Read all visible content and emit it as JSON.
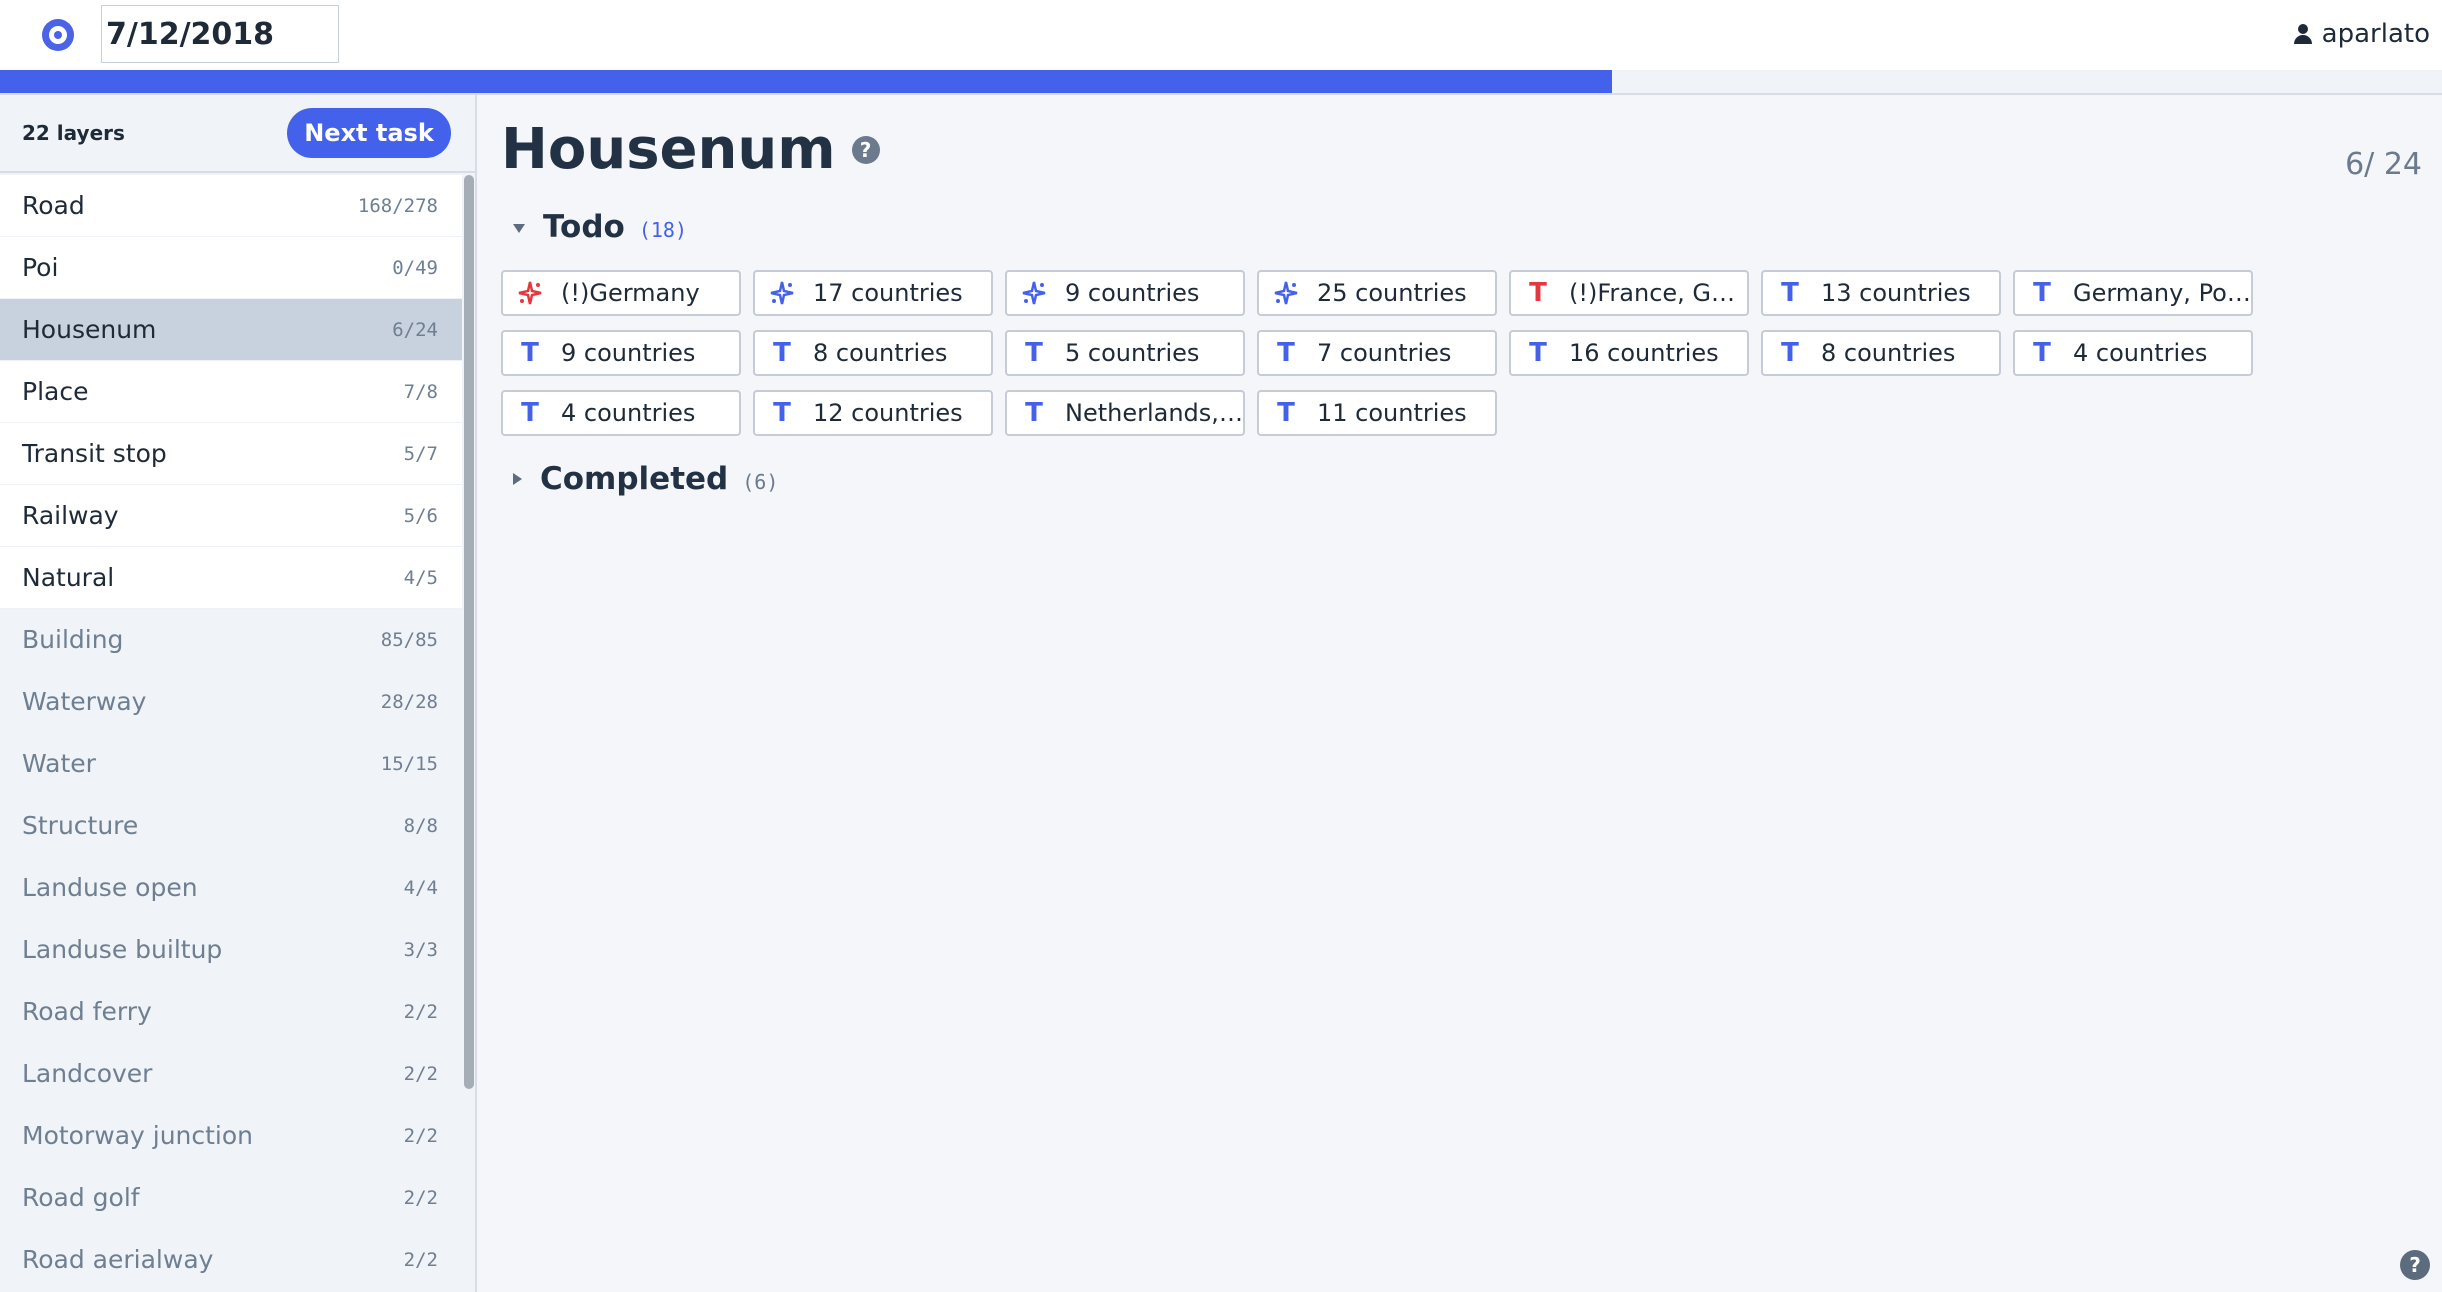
{
  "header": {
    "date": "7/12/2018",
    "user": "aparlato"
  },
  "progress": {
    "fraction": 0.66
  },
  "sidebar": {
    "layers_label": "22 layers",
    "next_task": "Next task",
    "layers": [
      {
        "name": "Road",
        "count": "168/278",
        "state": "active"
      },
      {
        "name": "Poi",
        "count": "0/49",
        "state": "active"
      },
      {
        "name": "Housenum",
        "count": "6/24",
        "state": "selected"
      },
      {
        "name": "Place",
        "count": "7/8",
        "state": "active"
      },
      {
        "name": "Transit stop",
        "count": "5/7",
        "state": "active"
      },
      {
        "name": "Railway",
        "count": "5/6",
        "state": "active"
      },
      {
        "name": "Natural",
        "count": "4/5",
        "state": "active"
      },
      {
        "name": "Building",
        "count": "85/85",
        "state": "done"
      },
      {
        "name": "Waterway",
        "count": "28/28",
        "state": "done"
      },
      {
        "name": "Water",
        "count": "15/15",
        "state": "done"
      },
      {
        "name": "Structure",
        "count": "8/8",
        "state": "done"
      },
      {
        "name": "Landuse open",
        "count": "4/4",
        "state": "done"
      },
      {
        "name": "Landuse builtup",
        "count": "3/3",
        "state": "done"
      },
      {
        "name": "Road ferry",
        "count": "2/2",
        "state": "done"
      },
      {
        "name": "Landcover",
        "count": "2/2",
        "state": "done"
      },
      {
        "name": "Motorway junction",
        "count": "2/2",
        "state": "done"
      },
      {
        "name": "Road golf",
        "count": "2/2",
        "state": "done"
      },
      {
        "name": "Road aerialway",
        "count": "2/2",
        "state": "done"
      }
    ]
  },
  "main": {
    "title": "Housenum",
    "counter": "6/ 24",
    "todo": {
      "label": "Todo",
      "count": "(18)",
      "tasks": [
        {
          "label": "(!)Germany",
          "icon": "sparkle-icon",
          "color": "#e5373d"
        },
        {
          "label": "17 countries",
          "icon": "sparkle-icon",
          "color": "#4461ec"
        },
        {
          "label": "9 countries",
          "icon": "sparkle-icon",
          "color": "#4461ec"
        },
        {
          "label": "25 countries",
          "icon": "sparkle-icon",
          "color": "#4461ec"
        },
        {
          "label": "(!)France, Ger...",
          "icon": "text-icon",
          "color": "#e5373d"
        },
        {
          "label": "13 countries",
          "icon": "text-icon",
          "color": "#4461ec"
        },
        {
          "label": "Germany, Pol...",
          "icon": "text-icon",
          "color": "#4461ec"
        },
        {
          "label": "9 countries",
          "icon": "text-icon",
          "color": "#4461ec"
        },
        {
          "label": "8 countries",
          "icon": "text-icon",
          "color": "#4461ec"
        },
        {
          "label": "5 countries",
          "icon": "text-icon",
          "color": "#4461ec"
        },
        {
          "label": "7 countries",
          "icon": "text-icon",
          "color": "#4461ec"
        },
        {
          "label": "16 countries",
          "icon": "text-icon",
          "color": "#4461ec"
        },
        {
          "label": "8 countries",
          "icon": "text-icon",
          "color": "#4461ec"
        },
        {
          "label": "4 countries",
          "icon": "text-icon",
          "color": "#4461ec"
        },
        {
          "label": "4 countries",
          "icon": "text-icon",
          "color": "#4461ec"
        },
        {
          "label": "12 countries",
          "icon": "text-icon",
          "color": "#4461ec"
        },
        {
          "label": "Netherlands, ...",
          "icon": "text-icon",
          "color": "#4461ec"
        },
        {
          "label": "11 countries",
          "icon": "text-icon",
          "color": "#4461ec"
        }
      ]
    },
    "completed": {
      "label": "Completed",
      "count": "(6)"
    }
  }
}
